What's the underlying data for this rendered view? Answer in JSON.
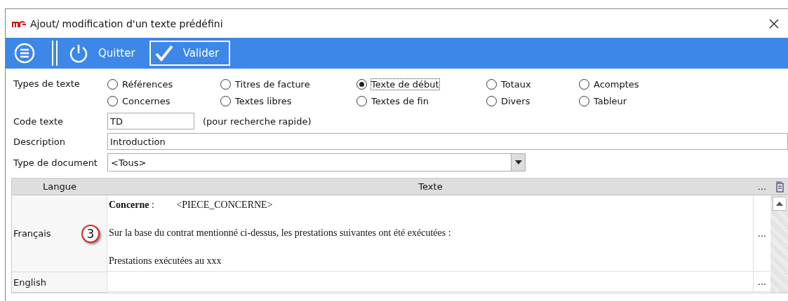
{
  "window": {
    "title": "Ajout/ modification d'un texte prédéfini"
  },
  "toolbar": {
    "buttons": [
      {
        "kind": "menu"
      },
      {
        "kind": "quit",
        "label": "Quitter"
      },
      {
        "kind": "validate",
        "label": "Valider"
      }
    ]
  },
  "types": {
    "label": "Types de texte",
    "options": [
      {
        "label": "Références",
        "selected": false
      },
      {
        "label": "Concernes",
        "selected": false
      },
      {
        "label": "Titres de facture",
        "selected": false
      },
      {
        "label": "Textes libres",
        "selected": false
      },
      {
        "label": "Texte de début",
        "selected": true
      },
      {
        "label": "Textes de fin",
        "selected": false
      },
      {
        "label": "Totaux",
        "selected": false
      },
      {
        "label": "Divers",
        "selected": false
      },
      {
        "label": "Acomptes",
        "selected": false
      },
      {
        "label": "Tableur",
        "selected": false
      }
    ]
  },
  "code": {
    "label": "Code texte",
    "value": "TD",
    "hint": "(pour recherche rapide)"
  },
  "description": {
    "label": "Description",
    "value": "Introduction"
  },
  "document_type": {
    "label": "Type de document",
    "value": "<Tous>"
  },
  "table": {
    "columns": [
      "Langue",
      "Texte",
      "..."
    ],
    "rows": [
      {
        "language": "Français",
        "badge": "3",
        "lines": [
          "**Concerne** :         <PIECE_CONCERNE>",
          "Sur la base du contrat mentionné ci-dessus, les prestations suivantes ont été exécutées :",
          "Prestations exécutées au xxx"
        ],
        "action": "..."
      },
      {
        "language": "English",
        "lines": [],
        "action": "..."
      }
    ]
  }
}
